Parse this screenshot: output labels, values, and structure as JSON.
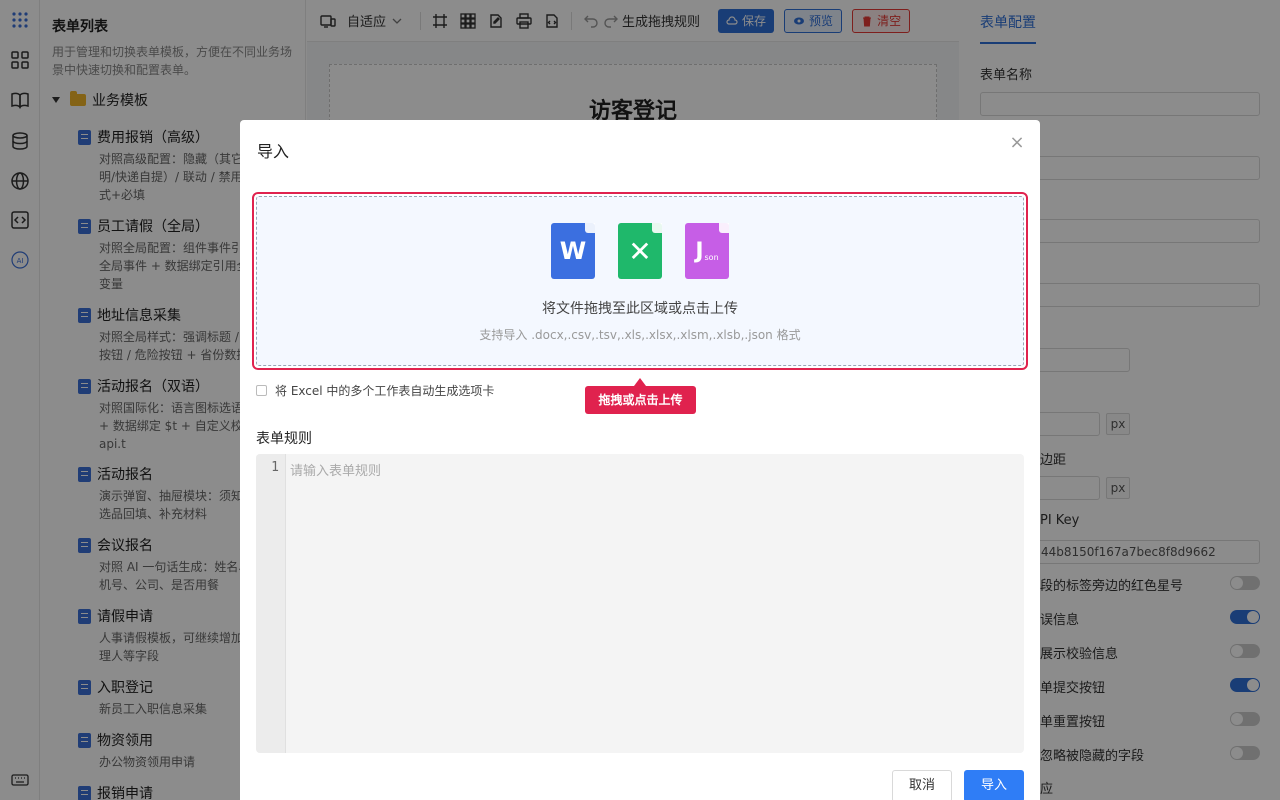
{
  "list_panel": {
    "title": "表单列表",
    "description": "用于管理和切换表单模板，方便在不同业务场景中快速切换和配置表单。",
    "group": "业务模板",
    "templates": [
      {
        "name": "费用报销（高级）",
        "desc": "对照高级配置：隐藏（其它\n明/快递自提）/ 联动 / 禁用\n式+必填"
      },
      {
        "name": "员工请假（全局）",
        "desc": "对照全局配置：组件事件引\n全局事件 + 数据绑定引用全\n变量"
      },
      {
        "name": "地址信息采集",
        "desc": "对照全局样式：强调标题 /\n按钮 / 危险按钮 + 省份数据"
      },
      {
        "name": "活动报名（双语）",
        "desc": "对照国际化：语言图标选语\n+ 数据绑定 $t + 自定义校验\napi.t"
      },
      {
        "name": "活动报名",
        "desc": "演示弹窗、抽屉模块：须知\n选品回填、补充材料"
      },
      {
        "name": "会议报名",
        "desc": "对照 AI 一句话生成：姓名、\n机号、公司、是否用餐"
      },
      {
        "name": "请假申请",
        "desc": "人事请假模板，可继续增加\n理人等字段"
      },
      {
        "name": "入职登记",
        "desc": "新员工入职信息采集"
      },
      {
        "name": "物资领用",
        "desc": "办公物资领用申请"
      },
      {
        "name": "报销申请",
        "desc": ""
      }
    ]
  },
  "toolbar": {
    "adaptive": "自适应",
    "generate_rules": "生成拖拽规则",
    "save": "保存",
    "preview": "预览",
    "clear": "清空"
  },
  "canvas": {
    "title": "访客登记"
  },
  "config": {
    "tab": "表单配置",
    "form_name_label": "表单名称",
    "margin_label": "边距",
    "api_key_label": "PI Key",
    "api_key_value": "44b8150f167a7bec8f8d9662",
    "px": "px",
    "switches": [
      {
        "label": "段的标签旁边的红色星号",
        "on": false
      },
      {
        "label": "误信息",
        "on": true
      },
      {
        "label": "展示校验信息",
        "on": false
      },
      {
        "label": "单提交按钮",
        "on": true
      },
      {
        "label": "单重置按钮",
        "on": false
      },
      {
        "label": "忽略被隐藏的字段",
        "on": false
      }
    ],
    "bottom_label": "应"
  },
  "modal": {
    "title": "导入",
    "close": "×",
    "drop_text": "将文件拖拽至此区域或点击上传",
    "drop_hint": "支持导入 .docx,.csv,.tsv,.xls,.xlsx,.xlsm,.xlsb,.json 格式",
    "file_icons": {
      "word": "W",
      "excel": "✕",
      "json": "J",
      "json_sub": "son"
    },
    "checkbox_label": "将 Excel 中的多个工作表自动生成选项卡",
    "tooltip": "拖拽或点击上传",
    "rules_label": "表单规则",
    "line_no": "1",
    "editor_placeholder": "请输入表单规则",
    "cancel": "取消",
    "import": "导入"
  },
  "colors": {
    "accent": "#2f6fd8",
    "highlight": "#e0224e",
    "word": "#3b6fe0",
    "excel": "#1fb86b",
    "json": "#c65ee6"
  }
}
